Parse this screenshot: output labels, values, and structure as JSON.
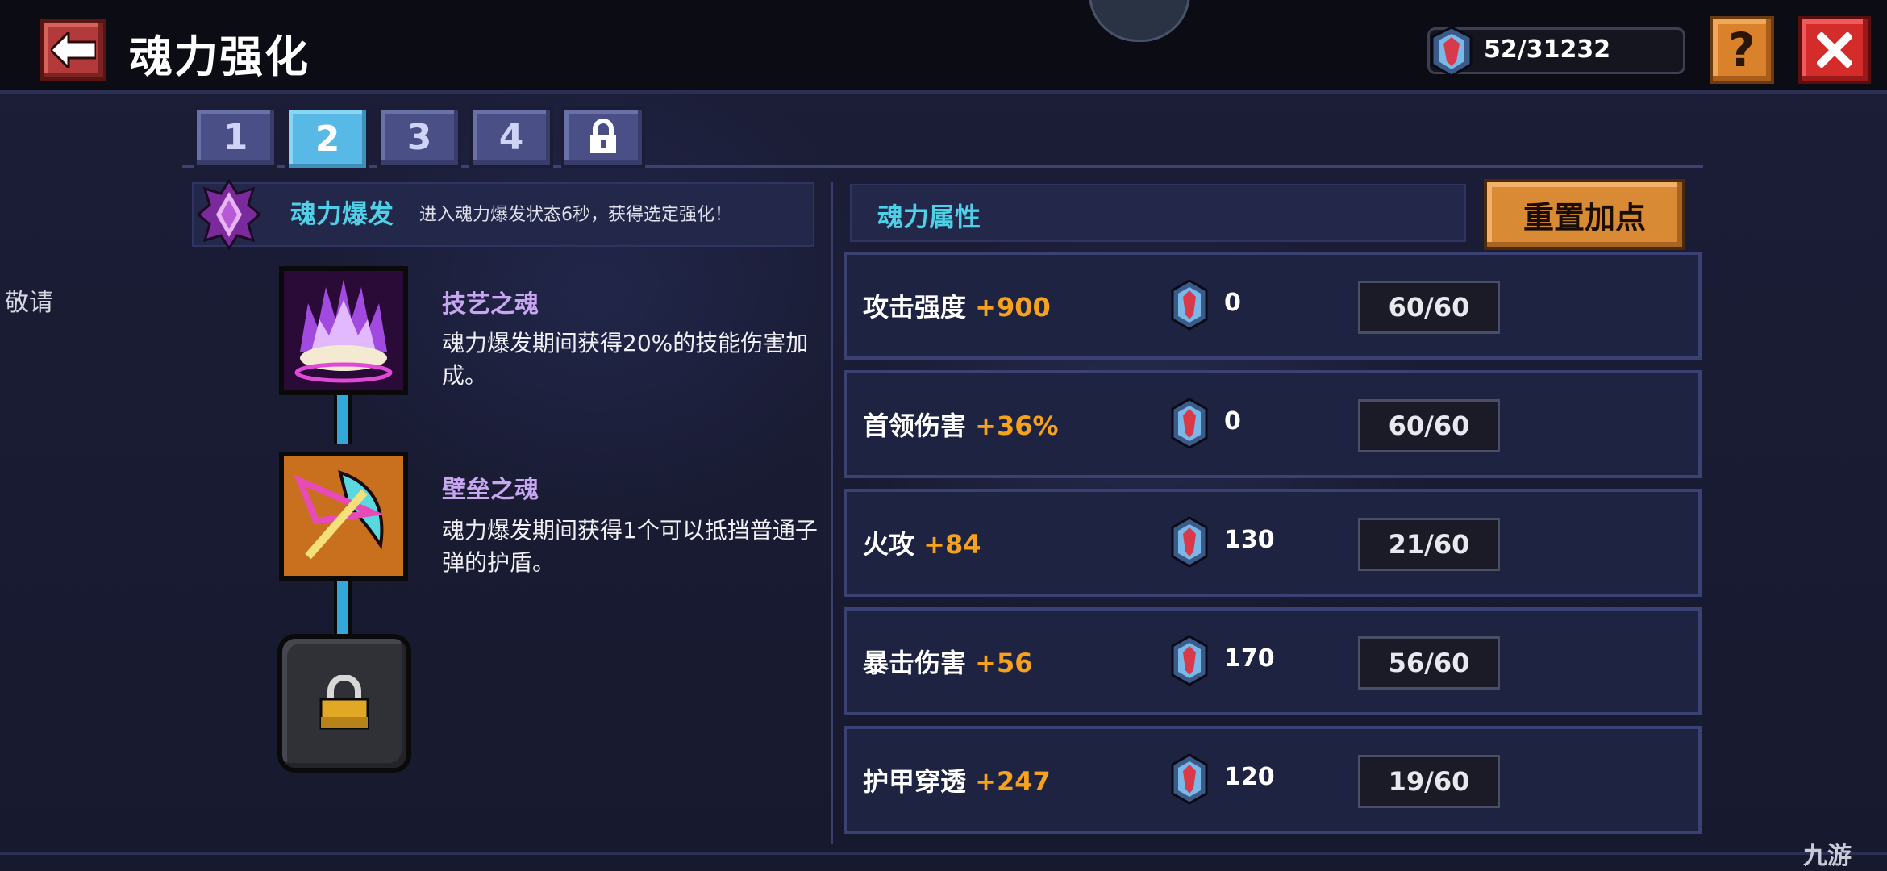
{
  "header": {
    "title": "魂力强化",
    "currency": "52/31232"
  },
  "side_text": "敬请",
  "tabs": [
    {
      "label": "1"
    },
    {
      "label": "2",
      "active": true
    },
    {
      "label": "3"
    },
    {
      "label": "4"
    },
    {
      "label": "",
      "icon": "lock-icon"
    }
  ],
  "burst": {
    "title": "魂力爆发",
    "desc": "进入魂力爆发状态6秒，获得选定强化！"
  },
  "skills": [
    {
      "name": "技艺之魂",
      "desc": "魂力爆发期间获得20%的技能伤害加成。",
      "icon": "purple-flame-icon"
    },
    {
      "name": "壁垒之魂",
      "desc": "魂力爆发期间获得1个可以抵挡普通子弹的护盾。",
      "icon": "shield-arrow-icon"
    },
    {
      "name": "",
      "desc": "",
      "icon": "padlock-icon",
      "locked": true
    }
  ],
  "attributes": {
    "title": "魂力属性",
    "reset_label": "重置加点",
    "rows": [
      {
        "label": "攻击强度",
        "bonus": "+900",
        "cost": "0",
        "level": "60/60"
      },
      {
        "label": "首领伤害",
        "bonus": "+36%",
        "cost": "0",
        "level": "60/60"
      },
      {
        "label": "火攻",
        "bonus": "+84",
        "cost": "130",
        "level": "21/60"
      },
      {
        "label": "暴击伤害",
        "bonus": "+56",
        "cost": "170",
        "level": "56/60"
      },
      {
        "label": "护甲穿透",
        "bonus": "+247",
        "cost": "120",
        "level": "19/60"
      }
    ]
  },
  "watermark": "九游",
  "colors": {
    "accent_cyan": "#4fd0e6",
    "bonus_orange": "#f5a21e",
    "skill_name_purple": "#c9a6f2"
  }
}
